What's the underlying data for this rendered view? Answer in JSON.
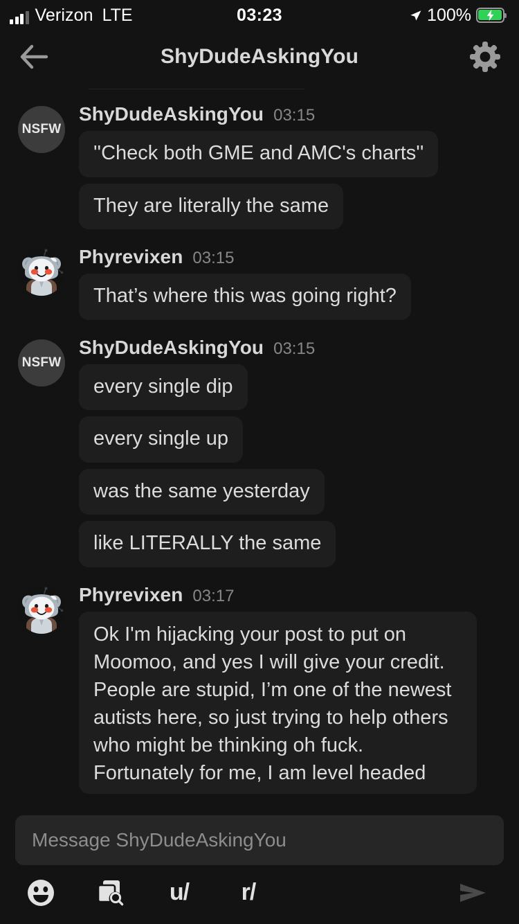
{
  "status_bar": {
    "carrier": "Verizon",
    "network": "LTE",
    "time": "03:23",
    "battery_percent": "100%",
    "battery_charging": true,
    "battery_color": "#31d158",
    "signal_bars_filled": 3,
    "signal_bars_total": 4,
    "location_icon": "location-arrow-icon"
  },
  "header": {
    "title": "ShyDudeAskingYou",
    "back_icon": "back-arrow-icon",
    "settings_icon": "gear-icon"
  },
  "conversation": {
    "groups": [
      {
        "username": "ShyDudeAskingYou",
        "timestamp": "03:15",
        "avatar_type": "nsfw",
        "avatar_label": "NSFW",
        "messages": [
          "''Check both GME and AMC's charts''",
          "They are literally the same"
        ]
      },
      {
        "username": "Phyrevixen",
        "timestamp": "03:15",
        "avatar_type": "snoo",
        "avatar_label": "",
        "messages": [
          "That’s where this was going right?"
        ]
      },
      {
        "username": "ShyDudeAskingYou",
        "timestamp": "03:15",
        "avatar_type": "nsfw",
        "avatar_label": "NSFW",
        "messages": [
          "every single dip",
          "every single up",
          "was the same yesterday",
          "like LITERALLY the same"
        ]
      },
      {
        "username": "Phyrevixen",
        "timestamp": "03:17",
        "avatar_type": "snoo",
        "avatar_label": "",
        "messages": [
          "Ok I'm hijacking your post to put on Moomoo, and yes I will give your credit. People are stupid, I’m one of the newest autists here, so just trying to help others who might be thinking oh fuck. Fortunately for me, I am level headed"
        ]
      }
    ]
  },
  "composer": {
    "placeholder": "Message ShyDudeAskingYou",
    "value": "",
    "tools": [
      {
        "name": "emoji-icon",
        "label": ""
      },
      {
        "name": "media-search-icon",
        "label": ""
      },
      {
        "name": "user-mention-icon",
        "label": "u/"
      },
      {
        "name": "subreddit-mention-icon",
        "label": "r/"
      }
    ],
    "send_icon": "send-arrow-icon",
    "send_enabled": false
  },
  "colors": {
    "page_background": "#131313",
    "bubble_background": "#1e1e1e",
    "input_background": "#262626",
    "text_primary": "#dcdcdc",
    "text_secondary": "#878787"
  }
}
